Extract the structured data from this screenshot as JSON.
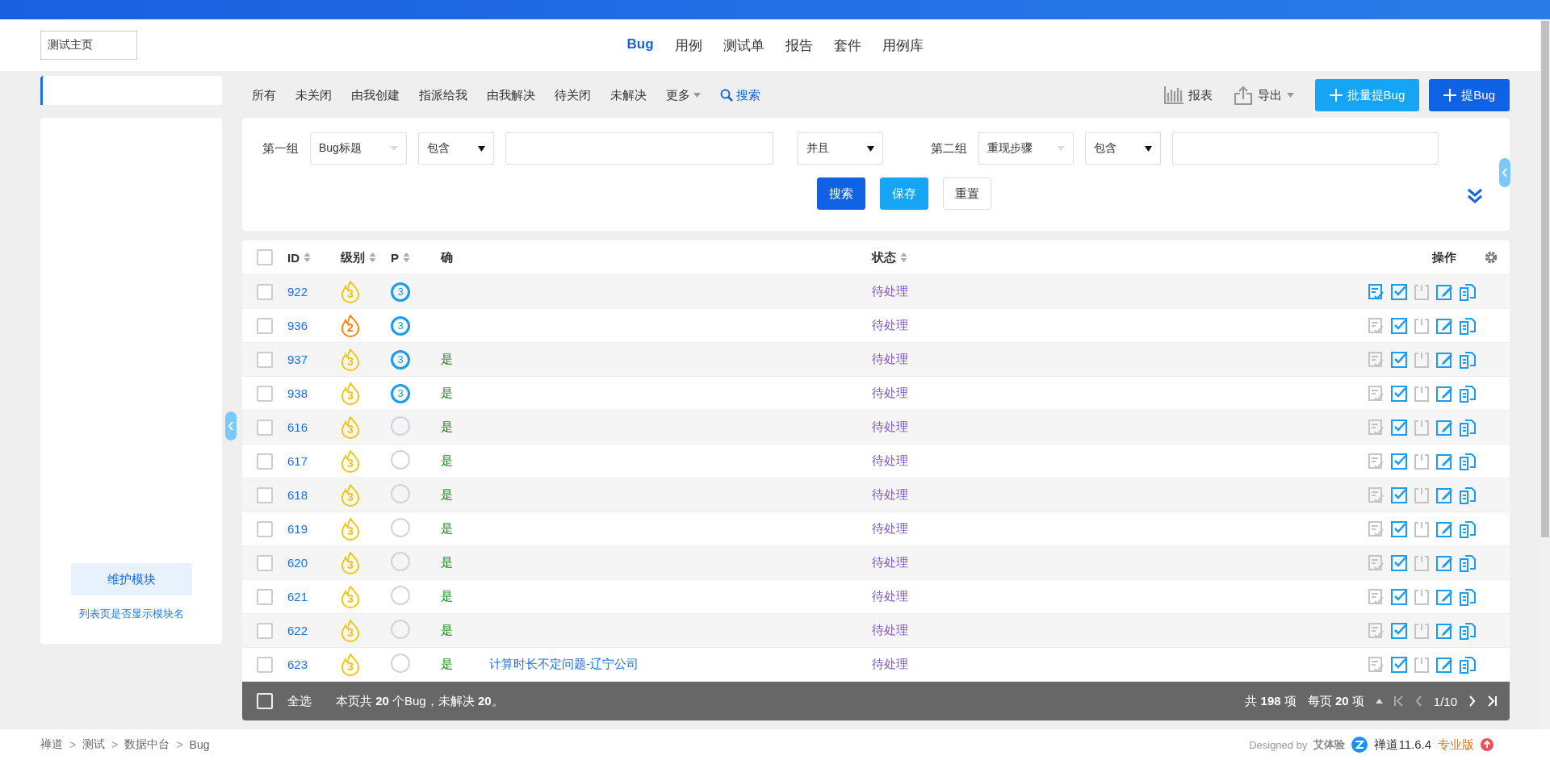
{
  "product_selector": {
    "value": "测试主页"
  },
  "app_tabs": [
    {
      "label": "Bug",
      "selected": true
    },
    {
      "label": "用例",
      "selected": false
    },
    {
      "label": "测试单",
      "selected": false
    },
    {
      "label": "报告",
      "selected": false
    },
    {
      "label": "套件",
      "selected": false
    },
    {
      "label": "用例库",
      "selected": false
    }
  ],
  "sidebar": {
    "maintain_button": "维护模块",
    "toggle_link": "列表页是否显示模块名"
  },
  "filters": [
    {
      "label": "所有",
      "kind": "plain"
    },
    {
      "label": "未关闭",
      "kind": "plain"
    },
    {
      "label": "由我创建",
      "kind": "plain"
    },
    {
      "label": "指派给我",
      "kind": "plain"
    },
    {
      "label": "由我解决",
      "kind": "plain"
    },
    {
      "label": "待关闭",
      "kind": "plain"
    },
    {
      "label": "未解决",
      "kind": "plain"
    },
    {
      "label": "更多",
      "kind": "dropdown"
    },
    {
      "label": "搜索",
      "kind": "search"
    }
  ],
  "toolbar": {
    "report": "报表",
    "export": "导出",
    "batch_create": "批量提Bug",
    "create": "提Bug"
  },
  "search_form": {
    "groups": [
      {
        "label": "第一组",
        "field": "Bug标题",
        "operator": "包含"
      },
      {
        "label": "第二组",
        "field": "重现步骤",
        "operator": "包含"
      }
    ],
    "and_or": "并且",
    "buttons": [
      {
        "label": "搜索",
        "kind": "primary"
      },
      {
        "label": "保存",
        "kind": "secondary"
      },
      {
        "label": "重置",
        "kind": "plain"
      }
    ]
  },
  "table": {
    "columns": [
      {
        "label": "ID",
        "sortable": true
      },
      {
        "label": "级别",
        "sortable": true
      },
      {
        "label": "P",
        "sortable": true
      },
      {
        "label": "确",
        "sortable": false
      },
      {
        "label": "状态",
        "sortable": true
      },
      {
        "label": "操作",
        "sortable": false
      }
    ],
    "rows": [
      {
        "id": "922",
        "severity": {
          "value": "3",
          "color": "#f5c400"
        },
        "pri": "3",
        "status": "待处理",
        "confirm_disabled": false,
        "checked": false
      },
      {
        "id": "936",
        "severity": {
          "value": "2",
          "color": "#ff7f00"
        },
        "pri": "3",
        "status": "待处理",
        "confirm_disabled": true,
        "checked": false
      },
      {
        "id": "937",
        "severity": {
          "value": "3",
          "color": "#f5c400"
        },
        "pri": "3",
        "confirmed": "是",
        "status": "待处理",
        "confirm_disabled": true,
        "checked": false
      },
      {
        "id": "938",
        "severity": {
          "value": "3",
          "color": "#f5c400"
        },
        "pri": "3",
        "confirmed": "是",
        "status": "待处理",
        "confirm_disabled": true,
        "checked": false
      },
      {
        "id": "616",
        "severity": {
          "value": "3",
          "color": "#f5c400"
        },
        "confirmed": "是",
        "status": "待处理",
        "confirm_disabled": true,
        "checked": false
      },
      {
        "id": "617",
        "severity": {
          "value": "3",
          "color": "#f5c400"
        },
        "confirmed": "是",
        "status": "待处理",
        "confirm_disabled": true,
        "checked": false
      },
      {
        "id": "618",
        "severity": {
          "value": "3",
          "color": "#f5c400"
        },
        "confirmed": "是",
        "status": "待处理",
        "confirm_disabled": true,
        "checked": false
      },
      {
        "id": "619",
        "severity": {
          "value": "3",
          "color": "#f5c400"
        },
        "confirmed": "是",
        "status": "待处理",
        "confirm_disabled": true,
        "checked": false
      },
      {
        "id": "620",
        "severity": {
          "value": "3",
          "color": "#f5c400"
        },
        "confirmed": "是",
        "status": "待处理",
        "confirm_disabled": true,
        "checked": false
      },
      {
        "id": "621",
        "severity": {
          "value": "3",
          "color": "#f5c400"
        },
        "confirmed": "是",
        "status": "待处理",
        "confirm_disabled": true,
        "checked": false
      },
      {
        "id": "622",
        "severity": {
          "value": "3",
          "color": "#f5c400"
        },
        "confirmed": "是",
        "status": "待处理",
        "confirm_disabled": true,
        "checked": false
      },
      {
        "id": "623",
        "severity": {
          "value": "3",
          "color": "#f5c400"
        },
        "confirmed": "是",
        "title": "计算时长不定问题-辽宁公司",
        "status": "待处理",
        "confirm_disabled": true,
        "checked": false
      }
    ]
  },
  "header_checked": false,
  "footer_bar": {
    "select_all_checked": false,
    "select_all": "全选",
    "summary": "本页共 **20** 个Bug，未解决 **20**。",
    "total": "共 **198** 项",
    "per_page": "每页 **20** 项",
    "page": "1/10"
  },
  "breadcrumb": {
    "separator": ">",
    "items": [
      "禅道",
      "测试",
      "数据中台",
      "Bug"
    ]
  },
  "credits": {
    "designed_by": "Designed by",
    "designer": "艾体验",
    "version": "禅道11.6.4",
    "edition": "专业版"
  }
}
